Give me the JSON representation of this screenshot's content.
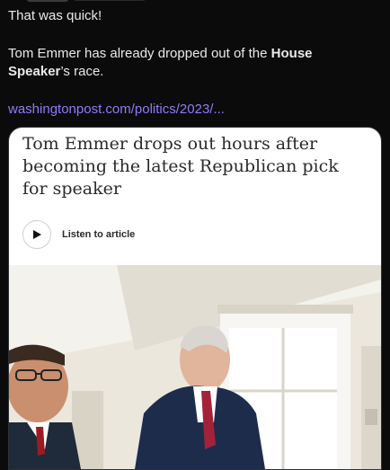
{
  "tweet": {
    "line1": "That was quick!",
    "line2_a": "Tom Emmer has already dropped out of the ",
    "line2_bold": "House Speaker",
    "line2_b": "’s race.",
    "link": "washingtonpost.com/politics/2023/..."
  },
  "card": {
    "headline": "Tom Emmer drops out hours after becoming the latest Republican pick for speaker",
    "listen_label": "Listen to article",
    "play_icon": "play-icon"
  },
  "colors": {
    "background": "#0b0b0b",
    "link": "#8f7cf7",
    "card_bg": "#ffffff",
    "headline": "#2a2a2a"
  }
}
